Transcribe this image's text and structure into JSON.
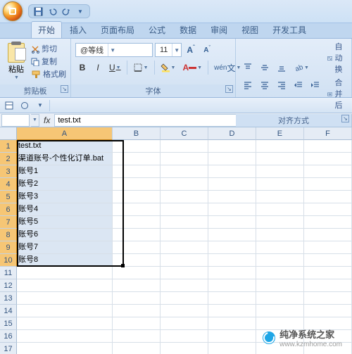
{
  "qat_icons": [
    "save-icon",
    "undo-icon",
    "redo-icon"
  ],
  "tabs": [
    {
      "label": "开始",
      "active": true
    },
    {
      "label": "插入",
      "active": false
    },
    {
      "label": "页面布局",
      "active": false
    },
    {
      "label": "公式",
      "active": false
    },
    {
      "label": "数据",
      "active": false
    },
    {
      "label": "审阅",
      "active": false
    },
    {
      "label": "视图",
      "active": false
    },
    {
      "label": "开发工具",
      "active": false
    }
  ],
  "ribbon": {
    "clipboard": {
      "paste": "粘贴",
      "cut": "剪切",
      "copy": "复制",
      "format_painter": "格式刷",
      "group_label": "剪贴板"
    },
    "font": {
      "font_name": "@等线",
      "font_size": "11",
      "group_label": "字体"
    },
    "alignment": {
      "wrap": "自动换",
      "merge": "合并后",
      "group_label": "对齐方式"
    }
  },
  "formula_bar": {
    "name_box": "",
    "fx": "fx",
    "value": "test.txt"
  },
  "columns": [
    "A",
    "B",
    "C",
    "D",
    "E",
    "F"
  ],
  "selected_col_index": 0,
  "rows": [
    1,
    2,
    3,
    4,
    5,
    6,
    7,
    8,
    9,
    10,
    11,
    12,
    13,
    14,
    15,
    16,
    17
  ],
  "selected_rows": [
    1,
    2,
    3,
    4,
    5,
    6,
    7,
    8,
    9,
    10
  ],
  "cell_data": {
    "1": "test.txt",
    "2": "渠道账号-个性化订单.bat",
    "3": "账号1",
    "4": "账号2",
    "5": "账号3",
    "6": "账号4",
    "7": "账号5",
    "8": "账号6",
    "9": "账号7",
    "10": "账号8"
  },
  "watermark": {
    "text": "纯净系统之家",
    "url": "www.kzmhome.com"
  }
}
